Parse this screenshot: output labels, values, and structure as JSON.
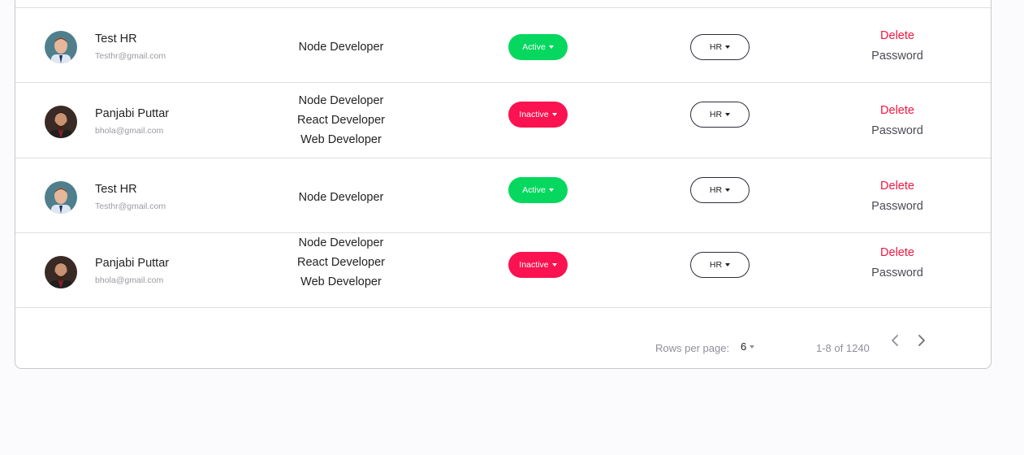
{
  "users": [
    {
      "name": "Test HR",
      "email": "Testhr@gmail.com",
      "avatar": "man-avatar",
      "roles": [
        "Node Developer"
      ],
      "status": "Active",
      "department": "HR",
      "action_delete": "Delete",
      "action_password": "Password"
    },
    {
      "name": "Panjabi Puttar",
      "email": "bhola@gmail.com",
      "avatar": "bearded-avatar",
      "roles": [
        "Node Developer",
        "React Developer",
        "Web Developer"
      ],
      "status": "Inactive",
      "department": "HR",
      "action_delete": "Delete",
      "action_password": "Password"
    },
    {
      "name": "Test HR",
      "email": "Testhr@gmail.com",
      "avatar": "man-avatar",
      "roles": [
        "Node Developer"
      ],
      "status": "Active",
      "department": "HR",
      "action_delete": "Delete",
      "action_password": "Password"
    },
    {
      "name": "Panjabi Puttar",
      "email": "bhola@gmail.com",
      "avatar": "bearded-avatar",
      "roles": [
        "Node Developer",
        "React Developer",
        "Web Developer"
      ],
      "status": "Inactive",
      "department": "HR",
      "action_delete": "Delete",
      "action_password": "Password"
    }
  ],
  "pagination": {
    "rows_per_page_label": "Rows per page:",
    "rows_per_page_value": "6",
    "range_text": "1-8 of 1240"
  },
  "colors": {
    "active": "#06d85f",
    "inactive": "#fb1250",
    "delete": "#f2163f"
  }
}
